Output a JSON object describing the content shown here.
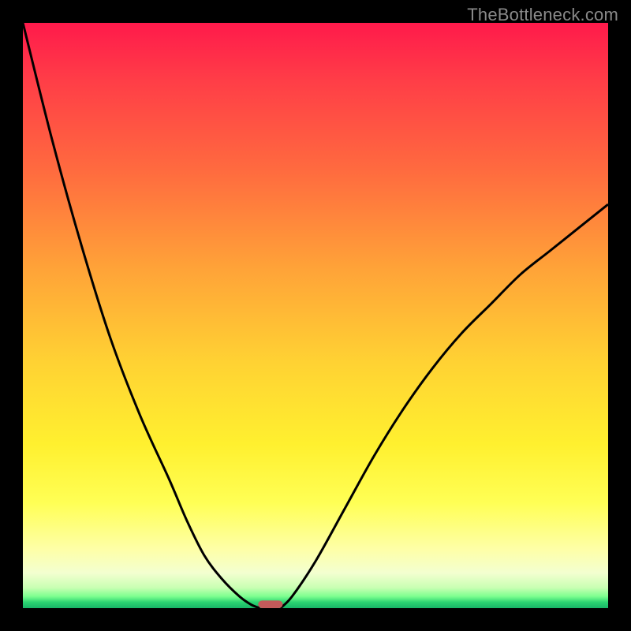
{
  "watermark": "TheBottleneck.com",
  "chart_data": {
    "type": "line",
    "title": "",
    "xlabel": "",
    "ylabel": "",
    "xlim": [
      0,
      100
    ],
    "ylim": [
      0,
      100
    ],
    "series": [
      {
        "name": "left-curve",
        "x": [
          0,
          5,
          10,
          15,
          20,
          25,
          28,
          31,
          34,
          37,
          39,
          40.5
        ],
        "y": [
          100,
          80,
          62,
          46,
          33,
          22,
          15,
          9,
          5,
          2,
          0.6,
          0
        ]
      },
      {
        "name": "right-curve",
        "x": [
          44,
          46,
          50,
          55,
          60,
          65,
          70,
          75,
          80,
          85,
          90,
          95,
          100
        ],
        "y": [
          0,
          2,
          8,
          17,
          26,
          34,
          41,
          47,
          52,
          57,
          61,
          65,
          69
        ]
      }
    ],
    "marker": {
      "name": "base-marker",
      "x": 42.3,
      "y": 0,
      "width_pct": 4.2,
      "color": "#c35a5a"
    },
    "gradient_note": "background encodes score: top=red (bad), bottom=green (good)"
  }
}
